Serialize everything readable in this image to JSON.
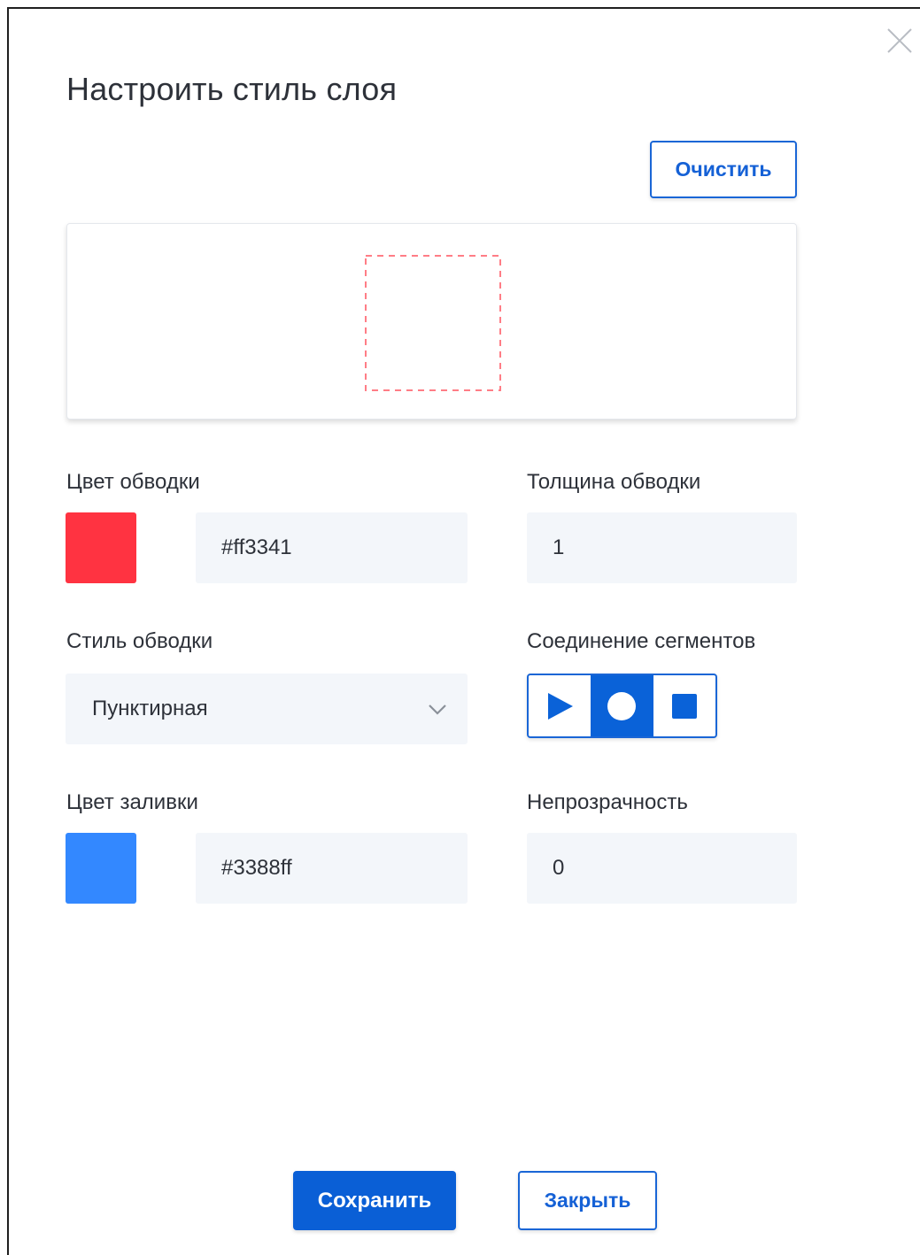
{
  "dialog": {
    "title": "Настроить стиль слоя",
    "close_icon": "close-icon",
    "clear_label": "Очистить",
    "save_label": "Сохранить",
    "close_label": "Закрыть"
  },
  "preview": {
    "stroke_color": "#ff3341",
    "stroke_style": "dashed",
    "fill_opacity": 0
  },
  "stroke_color": {
    "label": "Цвет обводки",
    "value": "#ff3341",
    "swatch_color": "#ff3341"
  },
  "stroke_width": {
    "label": "Толщина обводки",
    "value": "1"
  },
  "stroke_style": {
    "label": "Стиль обводки",
    "value": "Пунктирная"
  },
  "segment_join": {
    "label": "Соединение сегментов",
    "options": [
      {
        "icon": "triangle-join-icon",
        "selected": false
      },
      {
        "icon": "circle-join-icon",
        "selected": true
      },
      {
        "icon": "square-join-icon",
        "selected": false
      }
    ]
  },
  "fill_color": {
    "label": "Цвет заливки",
    "value": "#3388ff",
    "swatch_color": "#3388ff"
  },
  "opacity": {
    "label": "Непрозрачность",
    "value": "0"
  }
}
